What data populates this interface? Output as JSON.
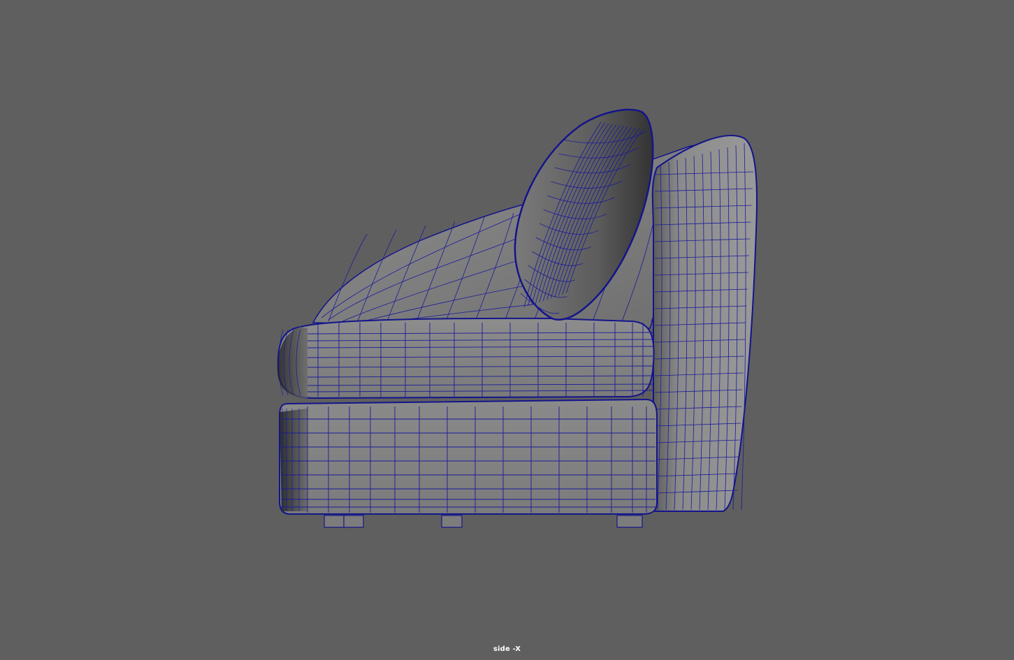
{
  "viewport": {
    "camera_label": "side -X",
    "background_color": "#5f5f5f",
    "wireframe_color": "#1a1a9a",
    "surface_color": "#808080"
  },
  "model": {
    "icon": "armchair-wireframe-icon"
  }
}
